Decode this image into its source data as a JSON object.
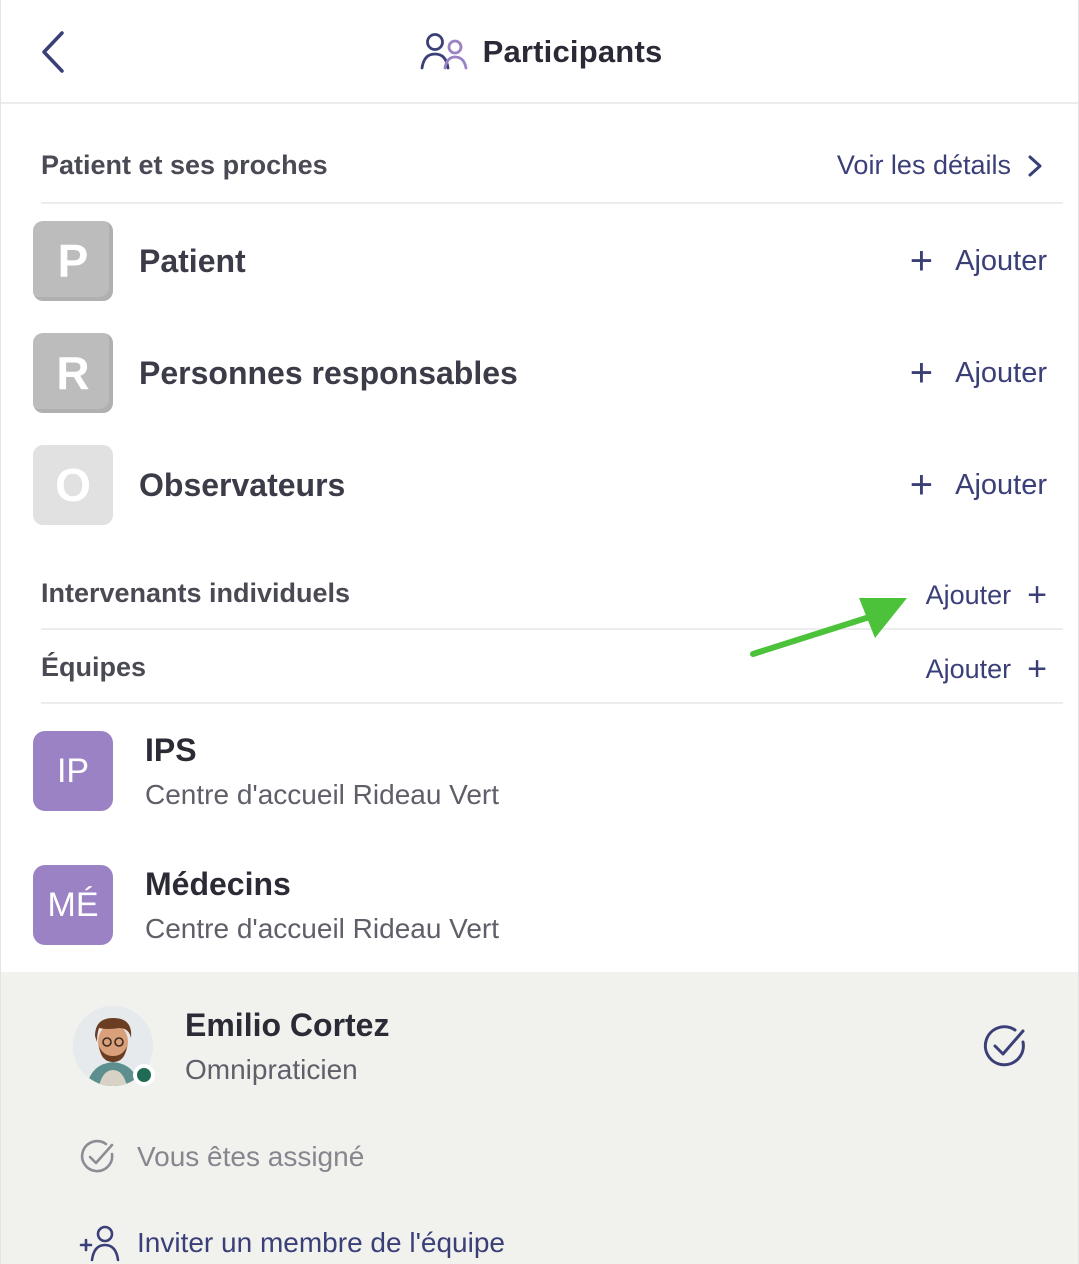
{
  "header": {
    "title": "Participants",
    "back_icon": "chevron-left-icon",
    "title_icon": "participants-icon"
  },
  "patient_section": {
    "label": "Patient et ses proches",
    "link_label": "Voir les détails",
    "link_icon": "chevron-right-icon"
  },
  "roles": [
    {
      "letter": "P",
      "label": "Patient",
      "add_label": "Ajouter",
      "tile": "gray"
    },
    {
      "letter": "R",
      "label": "Personnes responsables",
      "add_label": "Ajouter",
      "tile": "gray"
    },
    {
      "letter": "O",
      "label": "Observateurs",
      "add_label": "Ajouter",
      "tile": "light"
    }
  ],
  "individuals_section": {
    "label": "Intervenants individuels",
    "add_label": "Ajouter"
  },
  "teams_section": {
    "label": "Équipes",
    "add_label": "Ajouter"
  },
  "teams": [
    {
      "initials": "IP",
      "name": "IPS",
      "org": "Centre d'accueil Rideau Vert"
    },
    {
      "initials": "MÉ",
      "name": "Médecins",
      "org": "Centre d'accueil Rideau Vert"
    }
  ],
  "member": {
    "name": "Emilio Cortez",
    "role": "Omnipraticien",
    "status": "online"
  },
  "assigned_label": "Vous êtes assigné",
  "invite_label": "Inviter un membre de l'équipe",
  "colors": {
    "accent": "#3a3f78",
    "team_tile": "#9a82c4",
    "panel_bg": "#f1f2ee",
    "online": "#1f6b54",
    "annotation_arrow": "#4cc23a"
  }
}
